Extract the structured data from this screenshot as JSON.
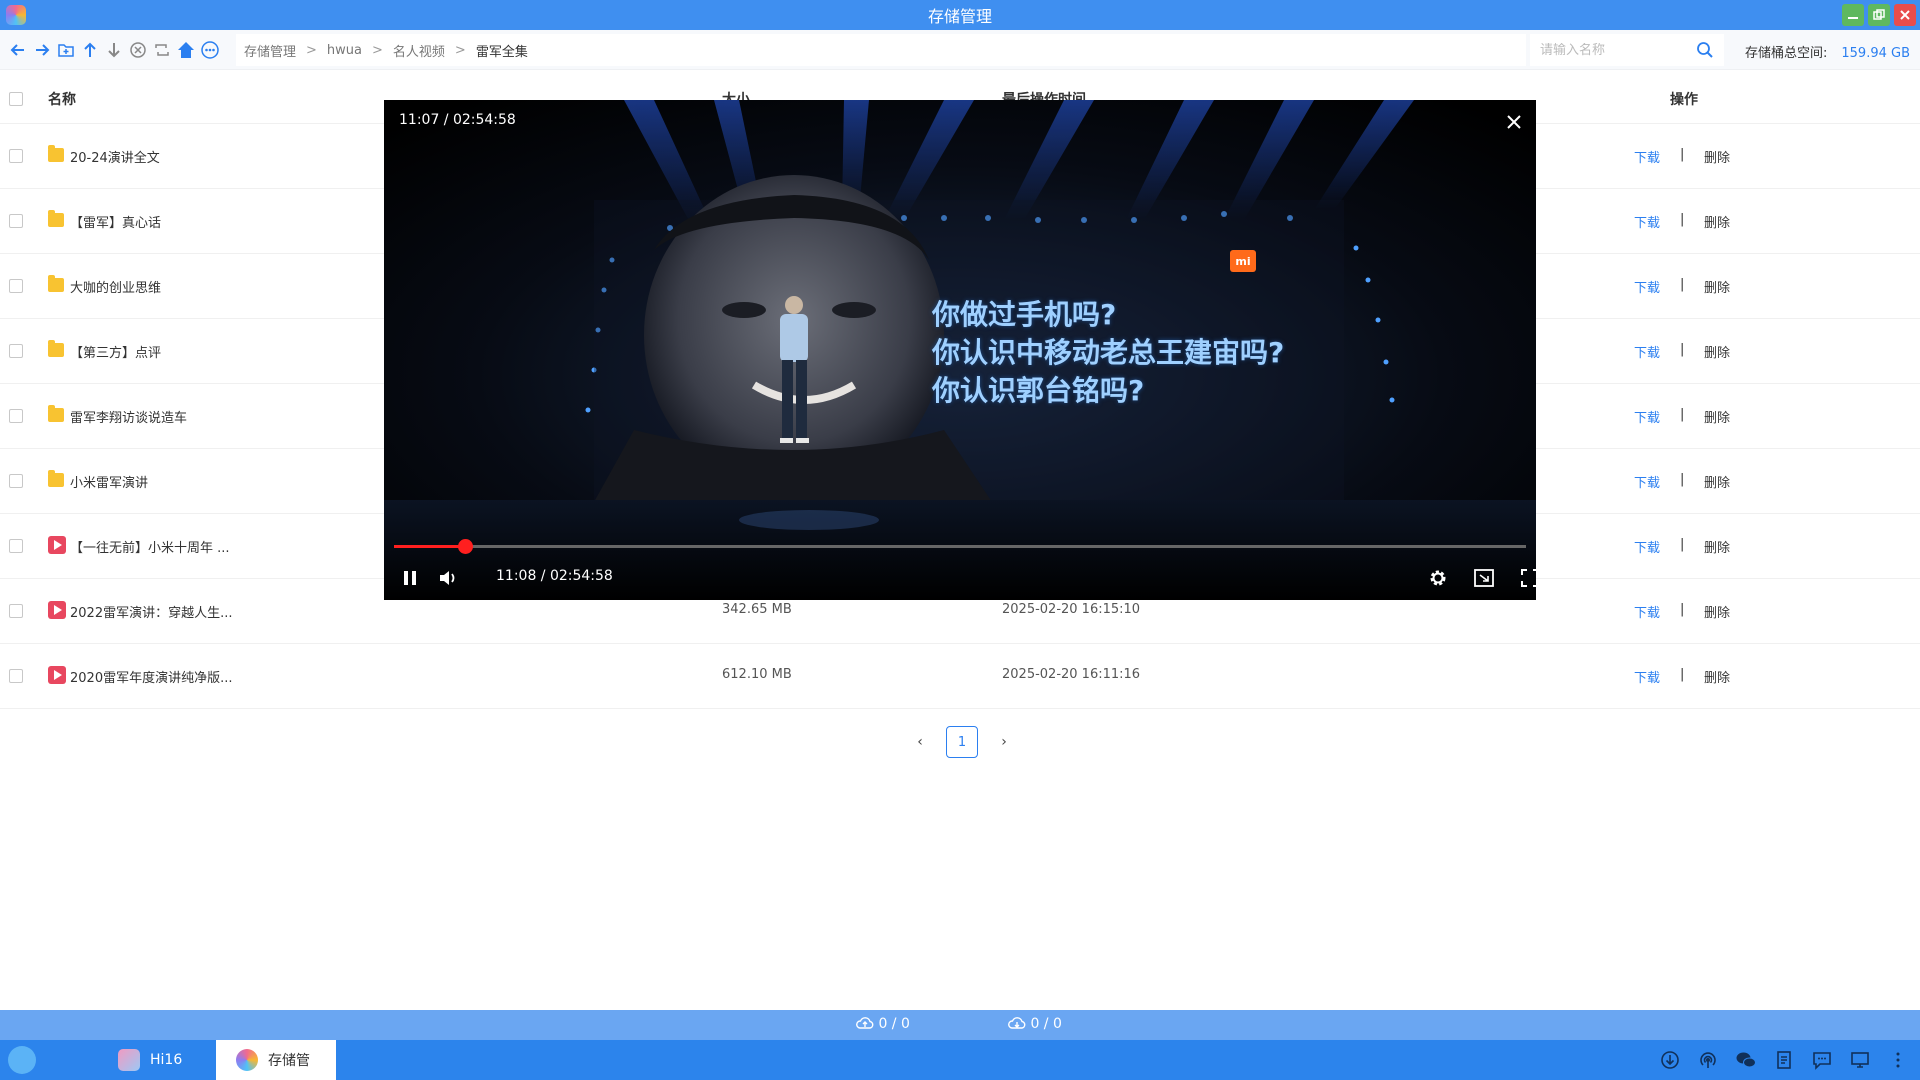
{
  "window": {
    "title": "存储管理"
  },
  "toolbar": {
    "breadcrumb": [
      "存储管理",
      "hwua",
      "名人视频",
      "雷军全集"
    ],
    "breadcrumb_sep": ">",
    "search_placeholder": "请输入名称",
    "storage_label": "存储桶总空间:",
    "storage_value": "159.94 GB"
  },
  "table": {
    "headers": {
      "name": "名称",
      "size": "大小",
      "time": "最后操作时间",
      "op": "操作"
    },
    "action_download": "下载",
    "action_sep": "|",
    "action_delete": "删除",
    "rows": [
      {
        "type": "folder",
        "name": "20-24演讲全文",
        "size": "",
        "time": ""
      },
      {
        "type": "folder",
        "name": "【雷军】真心话",
        "size": "",
        "time": ""
      },
      {
        "type": "folder",
        "name": "大咖的创业思维",
        "size": "",
        "time": ""
      },
      {
        "type": "folder",
        "name": "【第三方】点评",
        "size": "",
        "time": ""
      },
      {
        "type": "folder",
        "name": "雷军李翔访谈说造车",
        "size": "",
        "time": ""
      },
      {
        "type": "folder",
        "name": "小米雷军演讲",
        "size": "",
        "time": ""
      },
      {
        "type": "video",
        "name": "【一往无前】小米十周年 ...",
        "size": "",
        "time": ""
      },
      {
        "type": "video",
        "name": "2022雷军演讲：穿越人生...",
        "size": "342.65 MB",
        "time": "2025-02-20 16:15:10"
      },
      {
        "type": "video",
        "name": "2020雷军年度演讲纯净版...",
        "size": "612.10 MB",
        "time": "2025-02-20 16:11:16"
      }
    ]
  },
  "pagination": {
    "prev": "‹",
    "page": "1",
    "next": "›"
  },
  "transfer": {
    "upload": "0 / 0",
    "download": "0 / 0"
  },
  "taskbar": {
    "items": [
      "Hi16",
      "存储管"
    ]
  },
  "player": {
    "top_time": "11:07 / 02:54:58",
    "control_time": "11:08 / 02:54:58",
    "progress": 0.063,
    "slogan": [
      "你做过手机吗?",
      "你认识中移动老总王建宙吗?",
      "你认识郭台铭吗?"
    ],
    "logo_text": "mi"
  },
  "colors": {
    "accent": "#2b7ff0",
    "titlebar": "#3f8ff0",
    "taskbar": "#2c84ec",
    "progress": "#ff1f1f"
  }
}
